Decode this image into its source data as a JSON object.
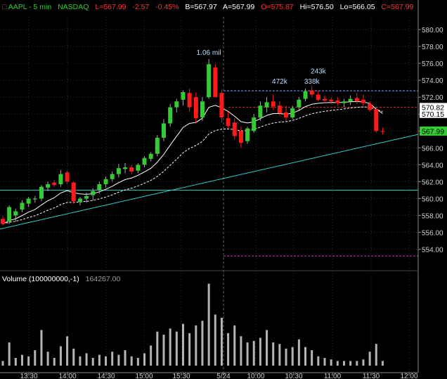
{
  "header": {
    "symbol_label": "AAPL - 5 min",
    "exchange": "NASDAQ",
    "last": "L=567.99",
    "change": "-2.57",
    "change_pct": "-0.45%",
    "bid": "B=567.97",
    "ask": "A=567.99",
    "open": "O=575.87",
    "high": "Hi=576.50",
    "low": "Lo=566.05",
    "close": "C=567.99"
  },
  "colors": {
    "background": "#000000",
    "up": "#33cc33",
    "down": "#ff1a1a",
    "ma_fast": "#ffffff",
    "ma_slow": "#ffffff",
    "trendline": "#33cccc",
    "resistance": "#8899ff",
    "red_level": "#cc3333",
    "magenta_level": "#cc33cc",
    "volume": "#b4b4b4",
    "axis_text": "#d0d0d0",
    "grid": "#4a4a4a"
  },
  "volume_panel": {
    "title": "Volume (100000000,-1)",
    "value": "164267.00"
  },
  "price_badges": {
    "last": "567.99",
    "red_level": "570.82",
    "white_level": "570.15"
  },
  "annotations": [
    {
      "text": "1.06 mil",
      "x": "5/24 9:30",
      "y": 577.0
    },
    {
      "text": "472k",
      "x": "10:25",
      "y": 573.6
    },
    {
      "text": "338k",
      "x": "10:50",
      "y": 573.6
    },
    {
      "text": "243k",
      "x": "10:55",
      "y": 574.8
    }
  ],
  "chart_data": {
    "type": "candlestick",
    "title": "AAPL - 5 min",
    "price_axis_ticks": [
      "554.00",
      "556.00",
      "558.00",
      "560.00",
      "562.00",
      "564.00",
      "566.00",
      "568.00",
      "570.00",
      "572.00",
      "574.00",
      "576.00",
      "578.00",
      "580.00"
    ],
    "price_range": [
      552.3,
      581.5
    ],
    "time_axis_ticks": [
      "13:30",
      "14:00",
      "14:30",
      "15:00",
      "15:30",
      "5/24",
      "10:00",
      "10:30",
      "11:00",
      "11:30",
      "12:00"
    ],
    "session_break": "5/24",
    "candles": [
      {
        "t": "d1 13:20",
        "o": 557.6,
        "h": 557.9,
        "l": 556.8,
        "c": 557.0,
        "v": 6
      },
      {
        "t": "d1 13:25",
        "o": 557.3,
        "h": 559.2,
        "l": 557.0,
        "c": 559.0,
        "v": 30
      },
      {
        "t": "d1 13:30",
        "o": 558.0,
        "h": 558.8,
        "l": 557.3,
        "c": 558.5,
        "v": 10
      },
      {
        "t": "d1 13:35",
        "o": 558.7,
        "h": 559.8,
        "l": 558.4,
        "c": 559.5,
        "v": 14
      },
      {
        "t": "d1 13:40",
        "o": 559.4,
        "h": 560.2,
        "l": 559.0,
        "c": 560.0,
        "v": 12
      },
      {
        "t": "d1 13:45",
        "o": 559.9,
        "h": 560.3,
        "l": 559.5,
        "c": 560.0,
        "v": 20
      },
      {
        "t": "d1 13:50",
        "o": 560.0,
        "h": 561.6,
        "l": 559.7,
        "c": 561.4,
        "v": 46
      },
      {
        "t": "d1 13:55",
        "o": 561.3,
        "h": 562.0,
        "l": 560.9,
        "c": 561.7,
        "v": 18
      },
      {
        "t": "d1 14:00",
        "o": 561.9,
        "h": 562.2,
        "l": 561.4,
        "c": 561.6,
        "v": 10
      },
      {
        "t": "d1 14:05",
        "o": 561.7,
        "h": 563.4,
        "l": 561.4,
        "c": 562.9,
        "v": 25
      },
      {
        "t": "d1 14:10",
        "o": 563.1,
        "h": 563.3,
        "l": 561.7,
        "c": 562.0,
        "v": 38
      },
      {
        "t": "d1 14:15",
        "o": 561.9,
        "h": 562.0,
        "l": 559.4,
        "c": 559.7,
        "v": 22
      },
      {
        "t": "d1 14:20",
        "o": 559.6,
        "h": 560.2,
        "l": 559.2,
        "c": 560.0,
        "v": 12
      },
      {
        "t": "d1 14:25",
        "o": 560.0,
        "h": 560.7,
        "l": 559.5,
        "c": 560.3,
        "v": 16
      },
      {
        "t": "d1 14:30",
        "o": 560.4,
        "h": 561.2,
        "l": 559.8,
        "c": 560.9,
        "v": 10
      },
      {
        "t": "d1 14:35",
        "o": 561.0,
        "h": 562.0,
        "l": 560.6,
        "c": 561.7,
        "v": 14
      },
      {
        "t": "d1 14:40",
        "o": 561.7,
        "h": 562.6,
        "l": 561.3,
        "c": 562.3,
        "v": 12
      },
      {
        "t": "d1 14:45",
        "o": 562.3,
        "h": 563.2,
        "l": 562.0,
        "c": 562.9,
        "v": 18
      },
      {
        "t": "d1 14:50",
        "o": 562.9,
        "h": 564.1,
        "l": 562.5,
        "c": 563.6,
        "v": 14
      },
      {
        "t": "d1 14:55",
        "o": 563.5,
        "h": 564.2,
        "l": 563.0,
        "c": 563.7,
        "v": 20
      },
      {
        "t": "d1 15:00",
        "o": 563.7,
        "h": 564.0,
        "l": 562.9,
        "c": 563.2,
        "v": 12
      },
      {
        "t": "d1 15:05",
        "o": 563.3,
        "h": 564.2,
        "l": 563.0,
        "c": 564.0,
        "v": 10
      },
      {
        "t": "d1 15:10",
        "o": 564.0,
        "h": 565.0,
        "l": 563.7,
        "c": 564.8,
        "v": 16
      },
      {
        "t": "d1 15:15",
        "o": 564.7,
        "h": 565.5,
        "l": 564.4,
        "c": 565.3,
        "v": 26
      },
      {
        "t": "d1 15:20",
        "o": 565.3,
        "h": 567.5,
        "l": 565.0,
        "c": 567.2,
        "v": 44
      },
      {
        "t": "d1 15:25",
        "o": 567.2,
        "h": 569.4,
        "l": 566.8,
        "c": 568.9,
        "v": 40
      },
      {
        "t": "d1 15:30",
        "o": 568.9,
        "h": 571.2,
        "l": 568.5,
        "c": 570.8,
        "v": 48
      },
      {
        "t": "d1 15:35",
        "o": 570.8,
        "h": 571.8,
        "l": 570.2,
        "c": 571.5,
        "v": 44
      },
      {
        "t": "d1 15:40",
        "o": 571.7,
        "h": 572.8,
        "l": 571.0,
        "c": 572.6,
        "v": 54
      },
      {
        "t": "d1 15:45",
        "o": 572.5,
        "h": 573.0,
        "l": 570.3,
        "c": 570.8,
        "v": 42
      },
      {
        "t": "d1 15:50",
        "o": 572.0,
        "h": 572.6,
        "l": 569.0,
        "c": 569.5,
        "v": 52
      },
      {
        "t": "d1 15:55",
        "o": 569.6,
        "h": 572.0,
        "l": 569.2,
        "c": 571.5,
        "v": 58
      },
      {
        "t": "d2 09:30",
        "o": 572.0,
        "h": 576.5,
        "l": 571.8,
        "c": 575.9,
        "v": 106
      },
      {
        "t": "d2 09:35",
        "o": 575.5,
        "h": 575.9,
        "l": 572.0,
        "c": 572.0,
        "v": 66
      },
      {
        "t": "d2 09:40",
        "o": 572.5,
        "h": 572.9,
        "l": 569.0,
        "c": 569.6,
        "v": 62
      },
      {
        "t": "d2 09:45",
        "o": 569.5,
        "h": 570.3,
        "l": 568.3,
        "c": 568.6,
        "v": 42
      },
      {
        "t": "d2 09:50",
        "o": 569.0,
        "h": 569.5,
        "l": 567.0,
        "c": 567.4,
        "v": 52
      },
      {
        "t": "d2 09:55",
        "o": 568.0,
        "h": 568.5,
        "l": 566.0,
        "c": 566.6,
        "v": 38
      },
      {
        "t": "d2 10:00",
        "o": 566.8,
        "h": 568.5,
        "l": 566.5,
        "c": 568.3,
        "v": 30
      },
      {
        "t": "d2 10:05",
        "o": 568.0,
        "h": 570.0,
        "l": 567.8,
        "c": 569.6,
        "v": 32
      },
      {
        "t": "d2 10:10",
        "o": 569.6,
        "h": 571.5,
        "l": 569.2,
        "c": 571.0,
        "v": 36
      },
      {
        "t": "d2 10:15",
        "o": 570.8,
        "h": 572.0,
        "l": 570.2,
        "c": 571.4,
        "v": 46
      },
      {
        "t": "d2 10:20",
        "o": 571.5,
        "h": 572.3,
        "l": 570.5,
        "c": 570.9,
        "v": 30
      },
      {
        "t": "d2 10:25",
        "o": 571.0,
        "h": 571.5,
        "l": 569.8,
        "c": 570.1,
        "v": 28
      },
      {
        "t": "d2 10:30",
        "o": 570.2,
        "h": 571.0,
        "l": 569.2,
        "c": 569.6,
        "v": 22
      },
      {
        "t": "d2 10:35",
        "o": 569.6,
        "h": 571.0,
        "l": 569.4,
        "c": 570.7,
        "v": 24
      },
      {
        "t": "d2 10:40",
        "o": 570.8,
        "h": 572.0,
        "l": 570.5,
        "c": 571.7,
        "v": 34
      },
      {
        "t": "d2 10:45",
        "o": 571.8,
        "h": 573.0,
        "l": 571.5,
        "c": 572.7,
        "v": 24
      },
      {
        "t": "d2 10:50",
        "o": 572.8,
        "h": 573.3,
        "l": 572.0,
        "c": 572.3,
        "v": 20
      },
      {
        "t": "d2 10:55",
        "o": 572.3,
        "h": 572.8,
        "l": 571.5,
        "c": 571.7,
        "v": 12
      },
      {
        "t": "d2 11:00",
        "o": 571.8,
        "h": 572.2,
        "l": 571.3,
        "c": 571.6,
        "v": 10
      },
      {
        "t": "d2 11:05",
        "o": 571.7,
        "h": 572.0,
        "l": 571.2,
        "c": 571.5,
        "v": 8
      },
      {
        "t": "d2 11:10",
        "o": 571.6,
        "h": 572.0,
        "l": 571.0,
        "c": 571.3,
        "v": 6
      },
      {
        "t": "d2 11:15",
        "o": 571.3,
        "h": 571.8,
        "l": 570.8,
        "c": 571.5,
        "v": 6
      },
      {
        "t": "d2 11:20",
        "o": 571.5,
        "h": 572.2,
        "l": 571.1,
        "c": 571.8,
        "v": 6
      },
      {
        "t": "d2 11:25",
        "o": 571.9,
        "h": 572.5,
        "l": 571.2,
        "c": 571.5,
        "v": 6
      },
      {
        "t": "d2 11:30",
        "o": 571.7,
        "h": 572.3,
        "l": 571.0,
        "c": 571.3,
        "v": 8
      },
      {
        "t": "d2 11:35",
        "o": 571.2,
        "h": 571.5,
        "l": 570.3,
        "c": 570.5,
        "v": 18
      },
      {
        "t": "d2 11:40",
        "o": 570.6,
        "h": 570.8,
        "l": 567.8,
        "c": 568.0,
        "v": 28
      },
      {
        "t": "d2 11:45",
        "o": 568.0,
        "h": 568.4,
        "l": 567.6,
        "c": 567.99,
        "v": 6
      }
    ]
  }
}
